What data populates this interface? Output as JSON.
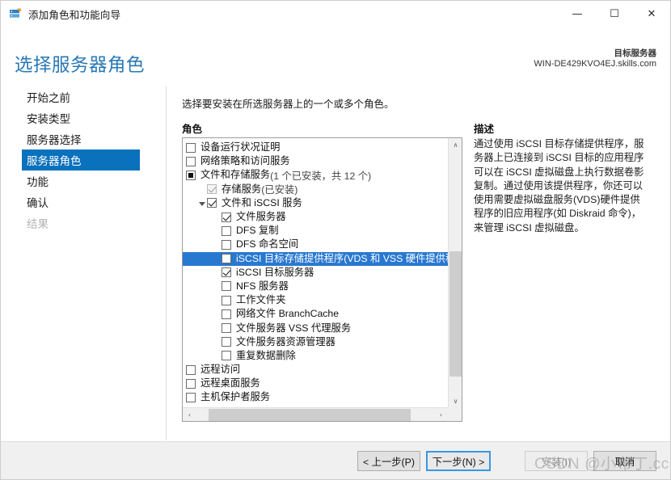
{
  "window": {
    "title": "添加角色和功能向导",
    "icon": "server-manager-icon",
    "minimize_glyph": "—",
    "maximize_glyph": "☐",
    "close_glyph": "✕"
  },
  "header": {
    "page_title": "选择服务器角色",
    "target_label": "目标服务器",
    "target_value": "WIN-DE429KVO4EJ.skills.com"
  },
  "sidebar": {
    "items": [
      {
        "label": "开始之前",
        "state": "normal"
      },
      {
        "label": "安装类型",
        "state": "normal"
      },
      {
        "label": "服务器选择",
        "state": "normal"
      },
      {
        "label": "服务器角色",
        "state": "selected"
      },
      {
        "label": "功能",
        "state": "normal"
      },
      {
        "label": "确认",
        "state": "normal"
      },
      {
        "label": "结果",
        "state": "disabled"
      }
    ]
  },
  "content": {
    "instruction": "选择要安装在所选服务器上的一个或多个角色。",
    "roles_heading": "角色",
    "description_heading": "描述",
    "description_text": "通过使用 iSCSI 目标存储提供程序，服务器上已连接到 iSCSI 目标的应用程序可以在 iSCSI 虚拟磁盘上执行数据卷影复制。通过使用该提供程序，你还可以使用需要虚拟磁盘服务(VDS)硬件提供程序的旧应用程序(如 Diskraid 命令)，来管理 iSCSI 虚拟磁盘。"
  },
  "roles_tree": [
    {
      "label": "设备运行状况证明",
      "suffix": "",
      "indent": 0,
      "check": "unchecked",
      "twisty": "none",
      "selected": false
    },
    {
      "label": "网络策略和访问服务",
      "suffix": "",
      "indent": 0,
      "check": "unchecked",
      "twisty": "none",
      "selected": false
    },
    {
      "label": "文件和存储服务",
      "suffix": " (1 个已安装，共 12 个)",
      "indent": 0,
      "check": "partial",
      "twisty": "none",
      "selected": false
    },
    {
      "label": "存储服务",
      "suffix": " (已安装)",
      "indent": 1,
      "check": "installed",
      "twisty": "none",
      "selected": false
    },
    {
      "label": "文件和 iSCSI 服务",
      "suffix": "",
      "indent": 1,
      "check": "checked",
      "twisty": "open",
      "selected": false
    },
    {
      "label": "文件服务器",
      "suffix": "",
      "indent": 2,
      "check": "checked",
      "twisty": "none",
      "selected": false
    },
    {
      "label": "DFS 复制",
      "suffix": "",
      "indent": 2,
      "check": "unchecked",
      "twisty": "none",
      "selected": false
    },
    {
      "label": "DFS 命名空间",
      "suffix": "",
      "indent": 2,
      "check": "unchecked",
      "twisty": "none",
      "selected": false
    },
    {
      "label": "iSCSI 目标存储提供程序(VDS 和 VSS 硬件提供程序)",
      "suffix": "",
      "indent": 2,
      "check": "unchecked",
      "twisty": "none",
      "selected": true
    },
    {
      "label": "iSCSI 目标服务器",
      "suffix": "",
      "indent": 2,
      "check": "checked",
      "twisty": "none",
      "selected": false
    },
    {
      "label": "NFS 服务器",
      "suffix": "",
      "indent": 2,
      "check": "unchecked",
      "twisty": "none",
      "selected": false
    },
    {
      "label": "工作文件夹",
      "suffix": "",
      "indent": 2,
      "check": "unchecked",
      "twisty": "none",
      "selected": false
    },
    {
      "label": "网络文件 BranchCache",
      "suffix": "",
      "indent": 2,
      "check": "unchecked",
      "twisty": "none",
      "selected": false
    },
    {
      "label": "文件服务器 VSS 代理服务",
      "suffix": "",
      "indent": 2,
      "check": "unchecked",
      "twisty": "none",
      "selected": false
    },
    {
      "label": "文件服务器资源管理器",
      "suffix": "",
      "indent": 2,
      "check": "unchecked",
      "twisty": "none",
      "selected": false
    },
    {
      "label": "重复数据删除",
      "suffix": "",
      "indent": 2,
      "check": "unchecked",
      "twisty": "none",
      "selected": false
    },
    {
      "label": "远程访问",
      "suffix": "",
      "indent": 0,
      "check": "unchecked",
      "twisty": "none",
      "selected": false
    },
    {
      "label": "远程桌面服务",
      "suffix": "",
      "indent": 0,
      "check": "unchecked",
      "twisty": "none",
      "selected": false
    },
    {
      "label": "主机保护者服务",
      "suffix": "",
      "indent": 0,
      "check": "unchecked",
      "twisty": "none",
      "selected": false
    }
  ],
  "scrollbars": {
    "vertical_up_glyph": "∧",
    "vertical_down_glyph": "∨",
    "horizontal_left_glyph": "‹",
    "horizontal_right_glyph": "›"
  },
  "footer": {
    "previous_label": "< 上一步(P)",
    "next_label": "下一步(N) >",
    "install_label": "安装(I)",
    "cancel_label": "取消"
  },
  "watermark": {
    "text": "CSDN @小布丁.cc"
  },
  "colors": {
    "accent_blue": "#0a71bd",
    "title_blue": "#2878b5",
    "selection_blue": "#2878d0",
    "footer_bg": "#f0f0f0",
    "scroll_thumb": "#cdcdcd"
  }
}
